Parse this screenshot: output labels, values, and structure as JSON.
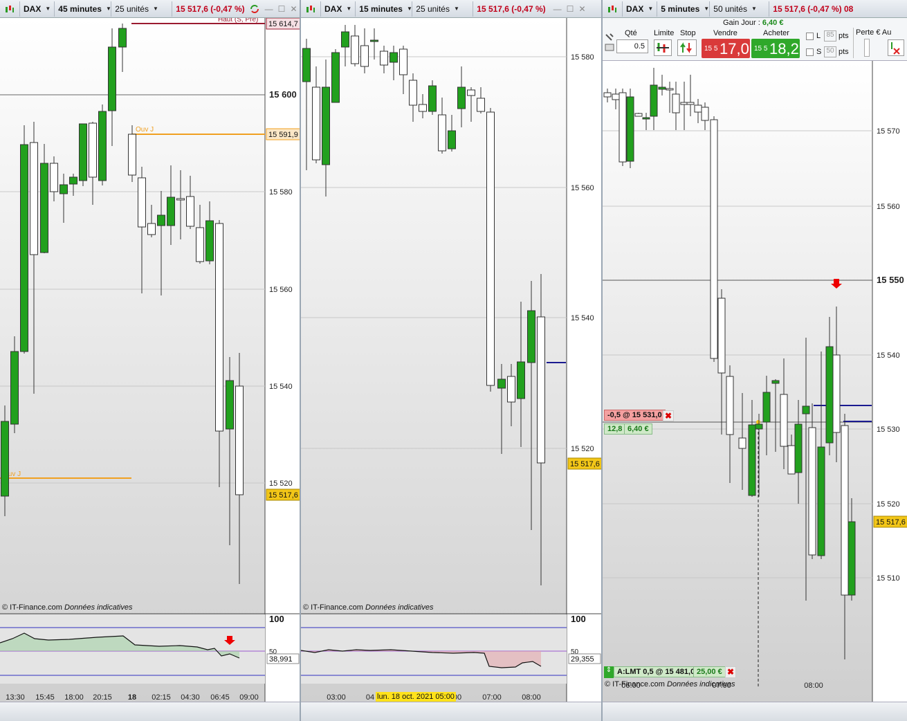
{
  "quote": {
    "symbol": "DAX",
    "last": "15 517,6 (-0,47 %)",
    "price_tag": "15 517,6"
  },
  "footer": {
    "copyright": "© IT-Finance.com",
    "note": "Données indicatives"
  },
  "panel1": {
    "timeframe": "45 minutes",
    "units": "25 unités",
    "levels": [
      {
        "label": "Haut (S, Pré)",
        "tag": "15 614,7",
        "color": "#9b1b30"
      },
      {
        "label": "Ouv J",
        "tag": "15 591,9",
        "color": "#f0a020"
      },
      {
        "label": "Ouv J",
        "tag": "",
        "color": "#f0a020"
      }
    ],
    "yticks": [
      "15 600",
      "15 580",
      "15 560",
      "15 540",
      "15 520"
    ],
    "xticks": [
      "13:30",
      "15:45",
      "18:00",
      "20:15",
      "18",
      "02:15",
      "04:30",
      "06:45",
      "09:00"
    ],
    "indicator": {
      "top": "100",
      "mid": "50",
      "value": "38,991"
    }
  },
  "panel2": {
    "timeframe": "15 minutes",
    "units": "25 unités",
    "yticks": [
      "15 580",
      "15 560",
      "15 540",
      "15 520"
    ],
    "xticks": [
      "03:00",
      "04",
      "00",
      "07:00",
      "08:00"
    ],
    "cursor_date": "lun. 18 oct. 2021 05:00",
    "indicator": {
      "top": "100",
      "mid": "50",
      "value": "29,355"
    }
  },
  "panel3": {
    "timeframe": "5 minutes",
    "units": "50 unités",
    "last_cut": "15 517,6 (-0,47 %) 08",
    "order": {
      "gain_label": "Gain Jour :",
      "gain_value": "6,40 €",
      "qty_label": "Qté",
      "qty_value": "0.5",
      "limit_label": "Limite",
      "stop_label": "Stop",
      "sell_label": "Vendre",
      "buy_label": "Acheter",
      "sell_prefix": "15 5",
      "sell_price": "17,0",
      "buy_prefix": "15 5",
      "buy_price": "18,2",
      "l_label": "L",
      "l_value": "85",
      "s_label": "S",
      "s_value": "50",
      "pts": "pts",
      "loss_label": "Perte € Au"
    },
    "position": {
      "label": "-0,5 @ 15 531,0",
      "pts": "12,8",
      "pnl": "6,40 €"
    },
    "pending": {
      "label": "A:LMT  0,5 @ 15 481,0",
      "value": "25,00 €"
    },
    "yticks": [
      "15 570",
      "15 560",
      "15 550",
      "15 540",
      "15 530",
      "15 520",
      "15 510"
    ],
    "xticks": [
      "06:00",
      "07:00",
      "08:00"
    ]
  },
  "colors": {
    "up": "#22a01e",
    "down": "#ffffff",
    "price_tag": "#f2c618",
    "sell": "#d93a3a",
    "buy": "#2fa82a"
  }
}
